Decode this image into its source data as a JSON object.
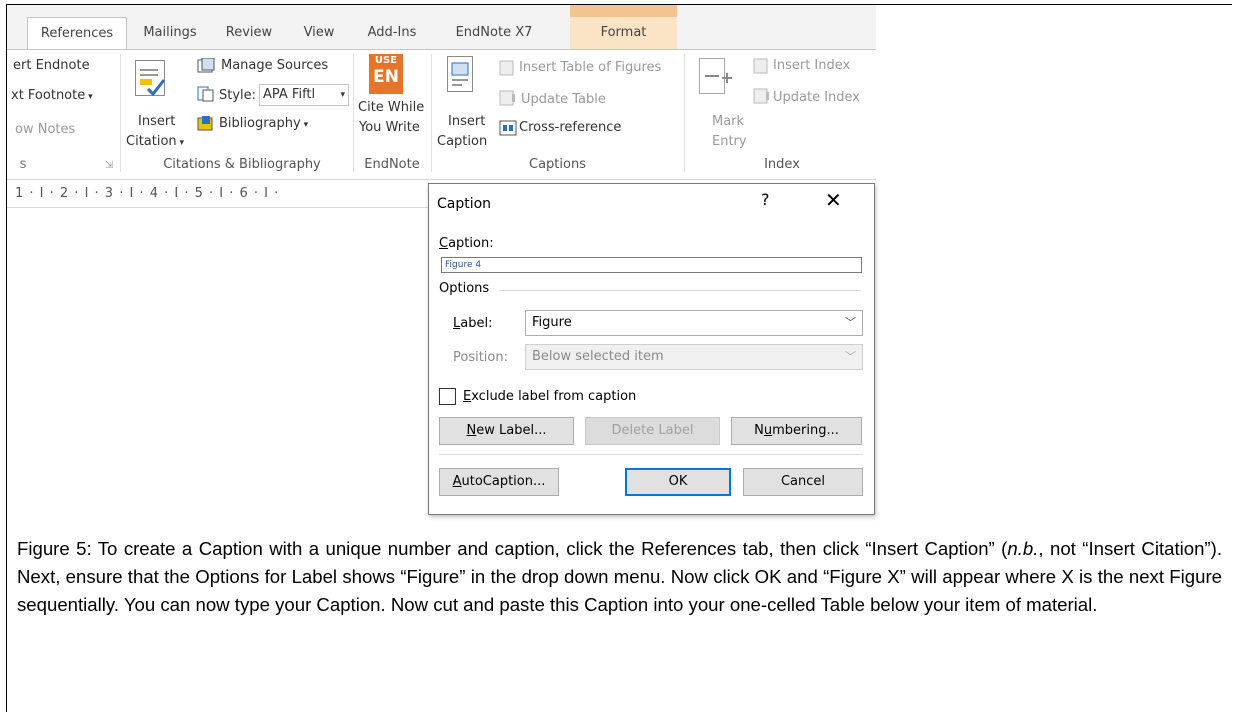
{
  "ribbon": {
    "tabs": [
      {
        "label": "References",
        "active": true
      },
      {
        "label": "Mailings"
      },
      {
        "label": "Review"
      },
      {
        "label": "View"
      },
      {
        "label": "Add-Ins"
      },
      {
        "label": "EndNote X7"
      },
      {
        "label": "Format",
        "contextual": true
      }
    ],
    "footnotes": {
      "insert_endnote": "ert Endnote",
      "next_footnote": "xt Footnote",
      "show_notes": "ow Notes",
      "group": "s"
    },
    "citations": {
      "insert_citation_1": "Insert",
      "insert_citation_2": "Citation",
      "manage_sources": "Manage Sources",
      "style_label": "Style:",
      "style_value": "APA Fiftl",
      "bibliography": "Bibliography",
      "group": "Citations & Bibliography"
    },
    "endnote": {
      "badge_top": "USE",
      "badge_bottom": "EN",
      "cite_1": "Cite While",
      "cite_2": "You Write",
      "group": "EndNote"
    },
    "captions": {
      "insert_caption_1": "Insert",
      "insert_caption_2": "Caption",
      "insert_table_of_figures": "Insert Table of Figures",
      "update_table": "Update Table",
      "cross_reference": "Cross-reference",
      "group": "Captions"
    },
    "index": {
      "mark_entry_1": "Mark",
      "mark_entry_2": "Entry",
      "insert_index": "Insert Index",
      "update_index": "Update Index",
      "group": "Index"
    }
  },
  "ruler": {
    "text": "1 · I · 2 · I · 3 · I · 4 · I · 5 · I · 6 · I ·"
  },
  "dialog": {
    "title": "Caption",
    "help": "?",
    "close": "✕",
    "caption_label": "Caption:",
    "caption_value": "Figure 4",
    "options_label": "Options",
    "label_label": "Label:",
    "label_value": "Figure",
    "position_label": "Position:",
    "position_value": "Below selected item",
    "exclude_label": "Exclude label from caption",
    "exclude_checked": false,
    "new_label": "New Label...",
    "delete_label": "Delete Label",
    "numbering": "Numbering...",
    "autocaption": "AutoCaption...",
    "ok": "OK",
    "cancel": "Cancel"
  },
  "figure_caption": {
    "part1": "Figure 5: To create a Caption with a unique number and caption, click the References tab, then click “Insert Caption” (",
    "nb": "n.b.",
    "part2": ", not “Insert Citation”). Next, ensure that the Options for Label shows “Figure” in the drop down menu. Now click OK and “Figure X” will appear where X is the next Figure sequentially. You can now type your Caption. Now cut and paste this Caption into your one-celled Table below your item of material."
  },
  "colors": {
    "accent": "#0078d7",
    "contextual_tab": "#f3c48f",
    "endnote_orange": "#e8742a"
  }
}
